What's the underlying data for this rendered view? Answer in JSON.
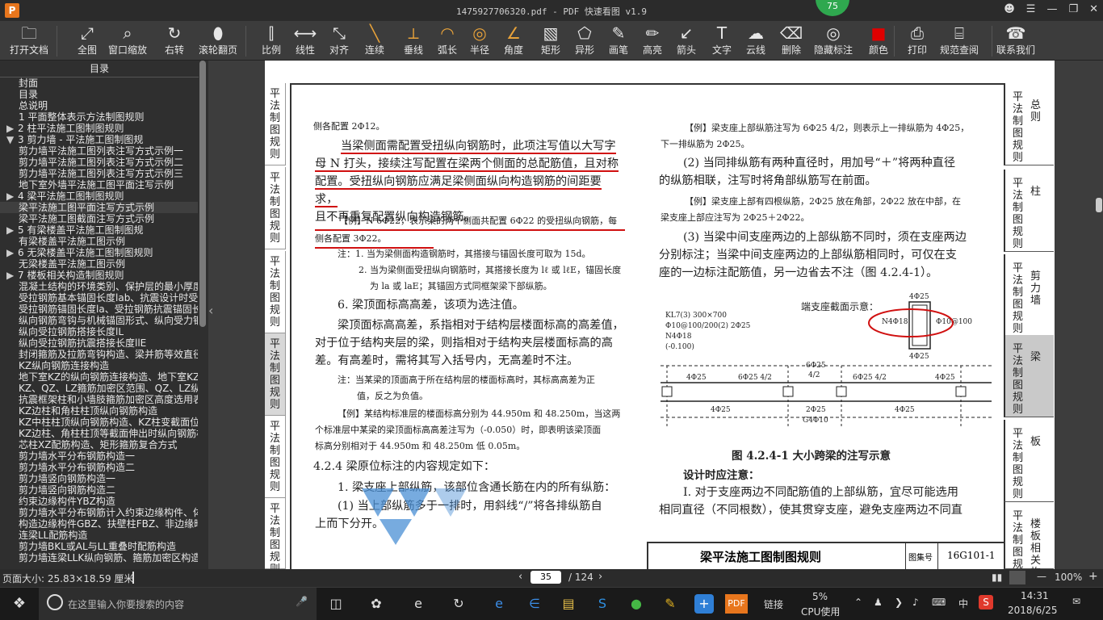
{
  "titlebar": {
    "title": "1475927706320.pdf - PDF 快速看图 v1.9",
    "app_logo": "P",
    "badge": "75"
  },
  "toolbar": {
    "tools": [
      {
        "label": "打开文档",
        "icon": "folder-icon"
      },
      {
        "label": "全图",
        "icon": "fit-page-icon"
      },
      {
        "label": "窗口缩放",
        "icon": "zoom-window-icon"
      },
      {
        "label": "右转",
        "icon": "rotate-right-icon"
      },
      {
        "label": "滚轮翻页",
        "icon": "mouse-wheel-icon"
      },
      {
        "label": "比例",
        "icon": "scale-ruler-icon"
      },
      {
        "label": "线性",
        "icon": "linear-measure-icon"
      },
      {
        "label": "对齐",
        "icon": "aligned-measure-icon"
      },
      {
        "label": "连续",
        "icon": "continuous-measure-icon"
      },
      {
        "label": "垂线",
        "icon": "perpendicular-icon"
      },
      {
        "label": "弧长",
        "icon": "arc-length-icon"
      },
      {
        "label": "半径",
        "icon": "radius-icon"
      },
      {
        "label": "角度",
        "icon": "angle-icon"
      },
      {
        "label": "矩形",
        "icon": "rectangle-area-icon"
      },
      {
        "label": "异形",
        "icon": "polygon-area-icon"
      },
      {
        "label": "画笔",
        "icon": "pen-icon"
      },
      {
        "label": "高亮",
        "icon": "highlighter-icon"
      },
      {
        "label": "箭头",
        "icon": "arrow-icon"
      },
      {
        "label": "文字",
        "icon": "text-icon"
      },
      {
        "label": "云线",
        "icon": "cloud-line-icon"
      },
      {
        "label": "删除",
        "icon": "eraser-icon"
      },
      {
        "label": "隐藏标注",
        "icon": "hide-markup-icon"
      },
      {
        "label": "颜色",
        "icon": "color-swatch-icon"
      },
      {
        "label": "打印",
        "icon": "print-icon"
      },
      {
        "label": "规范查阅",
        "icon": "book-icon"
      },
      {
        "label": "联系我们",
        "icon": "contact-icon"
      }
    ],
    "color_swatch": "#e00000"
  },
  "sidebar": {
    "title": "目录",
    "items": [
      {
        "label": "封面",
        "level": 2
      },
      {
        "label": "目录",
        "level": 2
      },
      {
        "label": "总说明",
        "level": 2
      },
      {
        "label": "1 平面整体表示方法制图规则",
        "level": 2
      },
      {
        "label": "2 柱平法施工图制图规则",
        "level": 1,
        "caret": "▶"
      },
      {
        "label": "3 剪力墙 - 平法施工图制图规",
        "level": 1,
        "caret": "▼"
      },
      {
        "label": "剪力墙平法施工图列表注写方式示例一",
        "level": 2
      },
      {
        "label": "剪力墙平法施工图列表注写方式示例二",
        "level": 2
      },
      {
        "label": "剪力墙平法施工图列表注写方式示例三",
        "level": 2
      },
      {
        "label": "地下室外墙平法施工图平面注写示例",
        "level": 2
      },
      {
        "label": "4 梁平法施工图制图规则",
        "level": 1,
        "caret": "▶"
      },
      {
        "label": "梁平法施工图平面注写方式示例",
        "level": 2,
        "selected": true
      },
      {
        "label": "梁平法施工图截面注写方式示例",
        "level": 2
      },
      {
        "label": "5 有梁楼盖平法施工图制图规",
        "level": 1,
        "caret": "▶"
      },
      {
        "label": "有梁楼盖平法施工图示例",
        "level": 2
      },
      {
        "label": "6 无梁楼盖平法施工图制图规则",
        "level": 1,
        "caret": "▶"
      },
      {
        "label": "无梁楼盖平法施工图示例",
        "level": 2
      },
      {
        "label": "7 楼板相关构造制图规则",
        "level": 1,
        "caret": "▶"
      },
      {
        "label": "混凝土结构的环境类别、保护层的最小厚度",
        "level": 2
      },
      {
        "label": "受拉钢筋基本锚固长度lab、抗震设计时受",
        "level": 2
      },
      {
        "label": "受拉钢筋锚固长度la、受拉钢筋抗震锚固长",
        "level": 2
      },
      {
        "label": "纵向钢筋弯钩与机械锚固形式、纵向受力钢",
        "level": 2
      },
      {
        "label": "纵向受拉钢筋搭接长度lL",
        "level": 2
      },
      {
        "label": "纵向受拉钢筋抗震搭接长度llE",
        "level": 2
      },
      {
        "label": "封闭箍筋及拉筋弯钩构造、梁并筋等效直径",
        "level": 2
      },
      {
        "label": "KZ纵向钢筋连接构造",
        "level": 2
      },
      {
        "label": "地下室KZ的纵向钢筋连接构造、地下室KZ的",
        "level": 2
      },
      {
        "label": "KZ、QZ、LZ箍筋加密区范围、QZ、LZ纵向钢",
        "level": 2
      },
      {
        "label": "抗震框架柱和小墙肢箍筋加密区高度选用表",
        "level": 2
      },
      {
        "label": "KZ边柱和角柱柱顶纵向钢筋构造",
        "level": 2
      },
      {
        "label": "KZ中柱柱顶纵向钢筋构造、KZ柱变截面位置",
        "level": 2
      },
      {
        "label": "KZ边柱、角柱柱顶等截面伸出时纵向钢筋构",
        "level": 2
      },
      {
        "label": "芯柱XZ配筋构造、矩形箍筋复合方式",
        "level": 2
      },
      {
        "label": "剪力墙水平分布钢筋构造一",
        "level": 2
      },
      {
        "label": "剪力墙水平分布钢筋构造二",
        "level": 2
      },
      {
        "label": "剪力墙竖向钢筋构造一",
        "level": 2
      },
      {
        "label": "剪力墙竖向钢筋构造二",
        "level": 2
      },
      {
        "label": "约束边缘构件YBZ构造",
        "level": 2
      },
      {
        "label": "剪力墙水平分布钢筋计入约束边缘构件、体",
        "level": 2
      },
      {
        "label": "构造边缘构件GBZ、扶壁柱FBZ、非边缘暗柱",
        "level": 2
      },
      {
        "label": "连梁LL配筋构造",
        "level": 2
      },
      {
        "label": "剪力墙BKL或AL与LL重叠时配筋构造",
        "level": 2
      },
      {
        "label": "剪力墙连梁LLK纵向钢筋、箍筋加密区构造",
        "level": 2
      }
    ]
  },
  "page": {
    "left_tabs": [
      {
        "label": "平法制图规则"
      },
      {
        "label": "平法制图规则"
      },
      {
        "label": "平法制图规则"
      },
      {
        "label": "平法制图规则",
        "active": true
      },
      {
        "label": "平法制图规则"
      },
      {
        "label": "平法制图规则"
      }
    ],
    "right_tabs": [
      {
        "a": "平法制图规则",
        "b": "总则"
      },
      {
        "a": "平法制图规则",
        "b": "柱"
      },
      {
        "a": "平法制图规则",
        "b": "剪力墙"
      },
      {
        "a": "平法制图规则",
        "b": "梁",
        "active": true
      },
      {
        "a": "平法制图规则",
        "b": "板"
      },
      {
        "a": "平法制图规则",
        "b": "楼板相关构造"
      }
    ],
    "left_col": {
      "p0": "侧各配置 2Φ12。",
      "p1a": "当梁侧面需配置受扭纵向钢筋时，此项注写值以大写字",
      "p1b": "母 N 打头，接续注写配置在梁两个侧面的总配筋值，且对称",
      "p1c": "配置。受扭纵向钢筋应满足梁侧面纵向构造钢筋的间距要求，",
      "p1d": "且不再重复配置纵向构造钢筋。",
      "ex1a": "【例】N 6Φ22，表示梁的两个侧面共配置 6Φ22 的受扭纵向钢筋，每",
      "ex1b": "侧各配置 3Φ22。",
      "note1": "注：1. 当为梁侧面构造钢筋时，其搭接与锚固长度可取为 15d。",
      "note2": "2. 当为梁侧面受扭纵向钢筋时，其搭接长度为 lℓ 或 lℓE，锚固长度",
      "note3": "为 la 或 laE；其锚固方式同框架梁下部纵筋。",
      "s6": "6. 梁顶面标高高差，该项为选注值。",
      "p2a": "梁顶面标高高差，系指相对于结构层楼面标高的高差值，",
      "p2b": "对于位于结构夹层的梁，则指相对于结构夹层楼面标高的高",
      "p2c": "差。有高差时，需将其写入括号内，无高差时不注。",
      "note4a": "注：当某梁的顶面高于所在结构层的楼面标高时，其标高高差为正",
      "note4b": "值，反之为负值。",
      "ex2a": "【例】某结构标准层的楼面标高分别为 44.950m 和 48.250m，当这两",
      "ex2b": "个标准层中某梁的梁顶面标高高差注写为（-0.050）时，即表明该梁顶面",
      "ex2c": "标高分别相对于 44.950m 和 48.250m 低 0.05m。",
      "h424": "4.2.4 梁原位标注的内容规定如下：",
      "p3": "1. 梁支座上部纵筋，该部位含通长筋在内的所有纵筋：",
      "p4a": "(1) 当上部纵筋多于一排时，用斜线“/”将各排纵筋自",
      "p4b": "上而下分开。"
    },
    "right_col": {
      "ex3a": "【例】梁支座上部纵筋注写为 6Φ25 4/2，则表示上一排纵筋为 4Φ25，",
      "ex3b": "下一排纵筋为 2Φ25。",
      "p5a": "(2) 当同排纵筋有两种直径时，用加号“＋”将两种直径",
      "p5b": "的纵筋相联，注写时将角部纵筋写在前面。",
      "ex4a": "【例】梁支座上部有四根纵筋，2Φ25 放在角部，2Φ22 放在中部，在",
      "ex4b": "梁支座上部应注写为 2Φ25＋2Φ22。",
      "p6a": "(3) 当梁中间支座两边的上部纵筋不同时，须在支座两边",
      "p6b": "分别标注；当梁中间支座两边的上部纵筋相同时，可仅在支",
      "p6c": "座的一边标注配筋值，另一边省去不注（图 4.2.4-1）。",
      "fig_caption": "图 4.2.4-1 大小跨梁的注写示意",
      "design_note": "设计时应注意：",
      "p7a": "Ⅰ. 对于支座两边不同配筋值的上部纵筋，宜尽可能选用",
      "p7b": "相同直径（不同根数），使其贯穿支座，避免支座两边不同直"
    },
    "figure": {
      "section_label": "端支座截面示意：",
      "kl": "KL7(3) 300×700",
      "stirrup": "Φ10@100/200(2) 2Φ25",
      "n": "N4Φ18",
      "elev": "(-0.100)",
      "top_bar": "4Φ25",
      "side_n": "N4Φ18",
      "stir_right": "Φ10@100",
      "bot_bar": "4Φ25",
      "lbl1": "4Φ25",
      "lbl2": "6Φ25 4/2",
      "lbl3": "6Φ25",
      "lbl3b": "4/2",
      "lbl4": "6Φ25 4/2",
      "lbl5": "4Φ25",
      "lbl6": "4Φ25",
      "lbl7": "2Φ25",
      "lbl8": "G4Φ10",
      "lbl9": "4Φ25"
    },
    "title_block": {
      "title": "梁平法施工图制图规则",
      "atlas_label": "图集号",
      "atlas_no": "16G101-1"
    }
  },
  "statusbar": {
    "page_size": "页面大小: 25.83×18.59 厘米",
    "current_page": "35",
    "total_pages": "/ 124",
    "zoom": "100%"
  },
  "taskbar": {
    "search_placeholder": "在这里输入你要搜索的内容",
    "link": "链接",
    "cpu_pct": "5%",
    "cpu_label": "CPU使用",
    "ime": "中",
    "time": "14:31",
    "date": "2018/6/25"
  }
}
